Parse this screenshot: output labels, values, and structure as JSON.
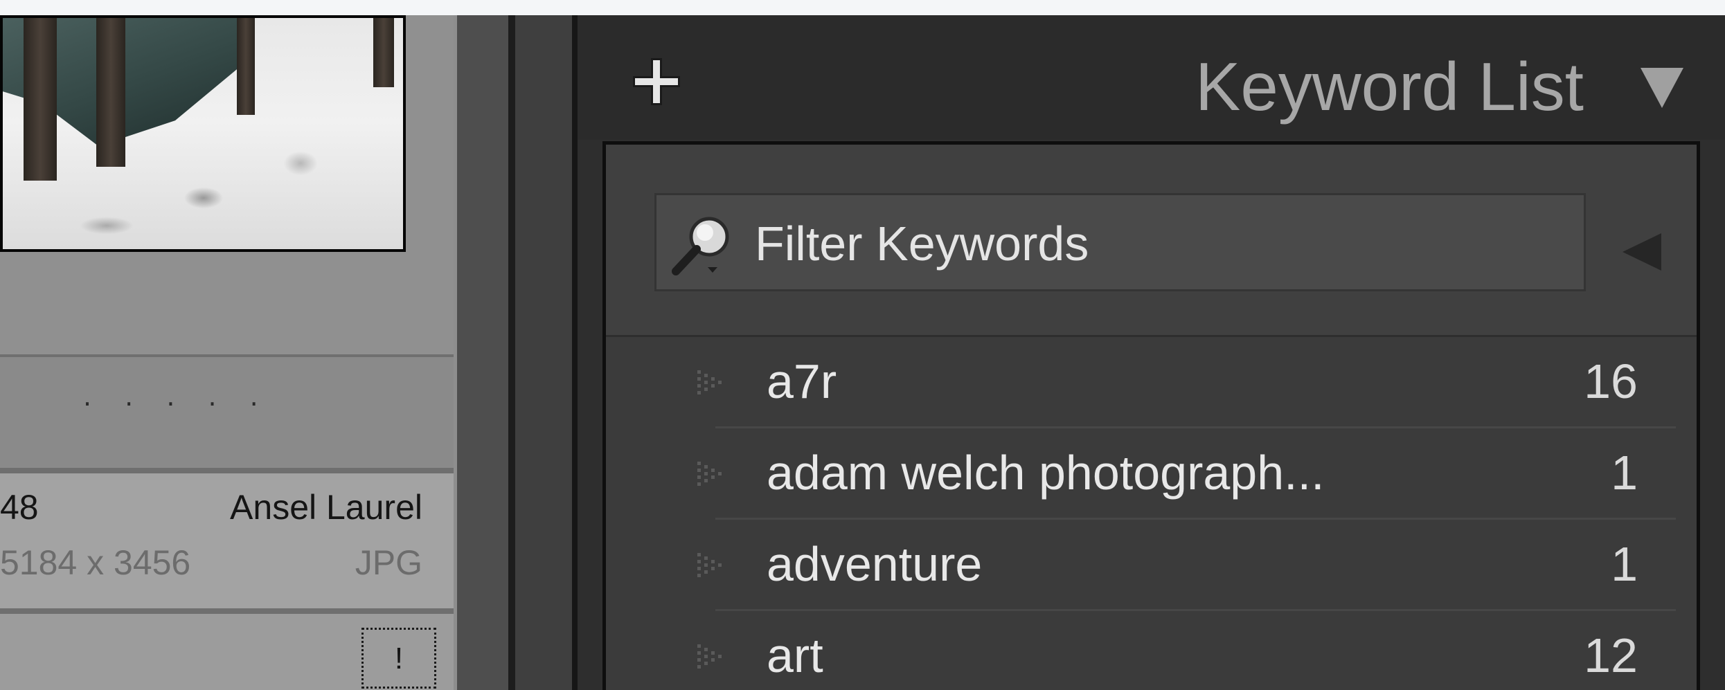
{
  "photo_cell": {
    "rating_dots": "· · · · ·",
    "index": "48",
    "author": "Ansel Laurel",
    "dimensions": "5184 x 3456",
    "filetype": "JPG",
    "badge": "!"
  },
  "keyword_panel": {
    "title": "Keyword List",
    "add_icon": "plus-icon",
    "collapse_icon": "triangle-down-icon",
    "filter": {
      "placeholder": "Filter Keywords",
      "value": "",
      "search_icon": "magnifier-icon",
      "clear_icon": "triangle-left-icon"
    },
    "items": [
      {
        "label": "a7r",
        "count": "16"
      },
      {
        "label": "adam welch photograph...",
        "count": "1"
      },
      {
        "label": "adventure",
        "count": "1"
      },
      {
        "label": "art",
        "count": "12"
      }
    ]
  },
  "colors": {
    "panel_bg": "#2e2e2e",
    "title_text": "#a7a7a7",
    "item_text": "#e8e8e8",
    "grid_bg": "#8e8e8e"
  }
}
